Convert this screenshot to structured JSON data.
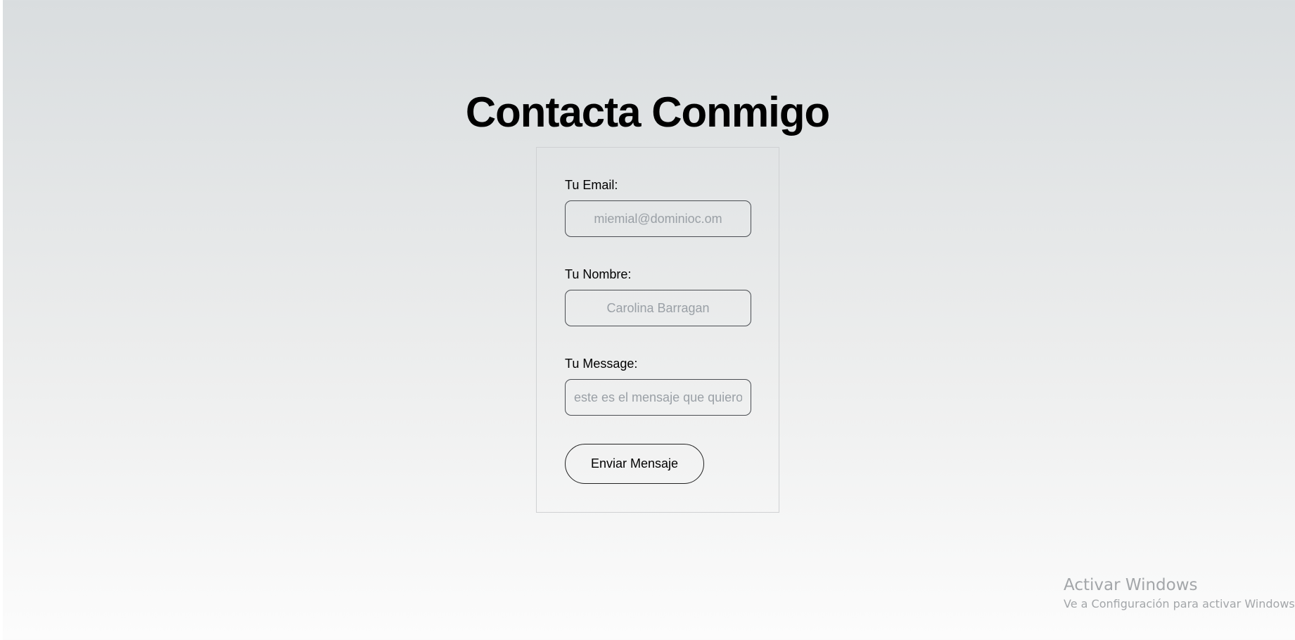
{
  "page": {
    "title": "Contacta Conmigo"
  },
  "form": {
    "email": {
      "label": "Tu Email:",
      "placeholder": "miemial@dominioc.om"
    },
    "name": {
      "label": "Tu Nombre:",
      "placeholder": "Carolina Barragan"
    },
    "message": {
      "label": "Tu Message:",
      "placeholder": "este es el mensaje que quiero enviar"
    },
    "submit_label": "Enviar Mensaje"
  },
  "watermark": {
    "title": "Activar Windows",
    "subtitle": "Ve a Configuración para activar Windows."
  },
  "colors": {
    "background_top": "#d9dddf",
    "background_bottom": "#fcfcfc",
    "card_border": "#cfd1d3",
    "input_border": "#4a4d52",
    "placeholder": "#9aa0a6",
    "watermark": "#a3a6a9"
  }
}
